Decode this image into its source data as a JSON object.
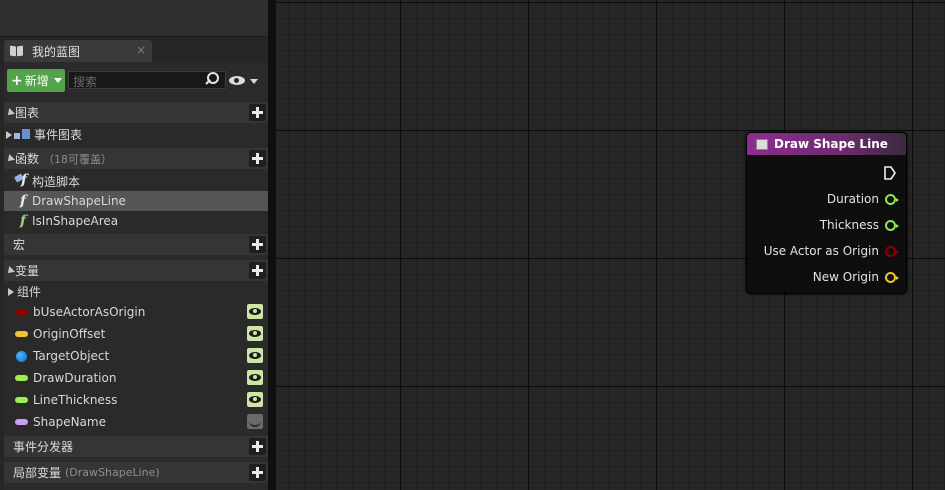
{
  "my_blueprint_tab": {
    "label": "我的蓝图",
    "close": "×"
  },
  "toolbar": {
    "new_label": "新增",
    "search_placeholder": "搜索"
  },
  "sections": {
    "graphs": {
      "label": "图表"
    },
    "event_graph": {
      "label": "事件图表"
    },
    "functions": {
      "label": "函数",
      "sub": "（18可覆盖）"
    },
    "macros": {
      "label": "宏"
    },
    "variables": {
      "label": "变量"
    },
    "components": {
      "label": "组件"
    },
    "event_dispatchers": {
      "label": "事件分发器"
    },
    "local_variables": {
      "label": "局部变量",
      "sub": "(DrawShapeLine)"
    }
  },
  "functions": [
    {
      "label": "构造脚本",
      "icon": "construction-script-icon"
    },
    {
      "label": "DrawShapeLine",
      "icon": "function-icon",
      "selected": true
    },
    {
      "label": "IsInShapeArea",
      "icon": "function-icon"
    }
  ],
  "variables": [
    {
      "label": "bUseActorAsOrigin",
      "type": "bool",
      "color": "#8b0000",
      "visible": true
    },
    {
      "label": "OriginOffset",
      "type": "vector",
      "color": "#f2c531",
      "visible": true
    },
    {
      "label": "TargetObject",
      "type": "object",
      "color": "#0a8ee6",
      "visible": true
    },
    {
      "label": "DrawDuration",
      "type": "float",
      "color": "#9cf04e",
      "visible": true
    },
    {
      "label": "LineThickness",
      "type": "float",
      "color": "#9cf04e",
      "visible": true
    },
    {
      "label": "ShapeName",
      "type": "name",
      "color": "#c9a0ef",
      "visible": false
    }
  ],
  "node": {
    "title": "Draw Shape Line",
    "header_color": "#8c2d8f",
    "pins": [
      {
        "label": "Duration",
        "color": "#8fe85a"
      },
      {
        "label": "Thickness",
        "color": "#8fe85a"
      },
      {
        "label": "Use Actor as Origin",
        "color": "#8a0000"
      },
      {
        "label": "New Origin",
        "color": "#f2c531"
      }
    ]
  }
}
